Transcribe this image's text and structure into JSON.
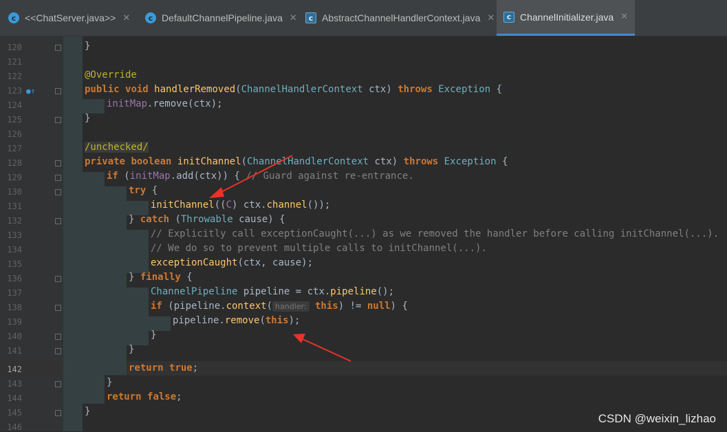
{
  "tabs": [
    {
      "label": "<<ChatServer.java>>",
      "icon": "class-icon",
      "active": false
    },
    {
      "label": "DefaultChannelPipeline.java",
      "icon": "class-icon",
      "active": false
    },
    {
      "label": "AbstractChannelHandlerContext.java",
      "icon": "abstract-class-icon",
      "active": false
    },
    {
      "label": "ChannelInitializer.java",
      "icon": "abstract-class-icon",
      "active": true
    }
  ],
  "close_glyph": "✕",
  "line_numbers": [
    "120",
    "121",
    "122",
    "123",
    "124",
    "125",
    "126",
    "127",
    "128",
    "129",
    "130",
    "131",
    "132",
    "133",
    "134",
    "135",
    "136",
    "137",
    "138",
    "139",
    "140",
    "141",
    "142",
    "143",
    "144",
    "145",
    "146"
  ],
  "current_line": "142",
  "code": {
    "l120": {
      "brace": "}"
    },
    "l122": {
      "annotation": "@Override"
    },
    "l123": {
      "kw1": "public",
      "kw2": "void",
      "name": "handlerRemoved",
      "p1": "(",
      "ptype": "ChannelHandlerContext",
      "pname": " ctx) ",
      "throws": "throws",
      "ex": "Exception",
      "brace": " {"
    },
    "l124": {
      "field": "initMap",
      "call": ".remove(ctx);"
    },
    "l125": {
      "brace": "}"
    },
    "l127": {
      "annotation": "/unchecked/"
    },
    "l128": {
      "kw1": "private",
      "kw2": "boolean",
      "name": "initChannel",
      "p1": "(",
      "ptype": "ChannelHandlerContext",
      "pname": " ctx) ",
      "throws": "throws",
      "ex": "Exception",
      "brace": " {"
    },
    "l129": {
      "kw": "if",
      "open": " (",
      "field": "initMap",
      "call": ".add(ctx)) { ",
      "comment": "// Guard against re-entrance."
    },
    "l130": {
      "kw": "try",
      "brace": " {"
    },
    "l131": {
      "fn": "initChannel",
      "rest1": "((",
      "gen": "C",
      "rest2": ") ctx.",
      "ch": "channel",
      "rest3": "());"
    },
    "l132": {
      "close": "} ",
      "kw": "catch",
      "open": " (",
      "ty": "Throwable",
      "rest": " cause) {"
    },
    "l133": {
      "comment": "// Explicitly call exceptionCaught(...) as we removed the handler before calling initChannel(...)."
    },
    "l134": {
      "comment": "// We do so to prevent multiple calls to initChannel(...)."
    },
    "l135": {
      "fn": "exceptionCaught",
      "rest": "(ctx, cause);"
    },
    "l136": {
      "close": "} ",
      "kw": "finally",
      "brace": " {"
    },
    "l137": {
      "ty": "ChannelPipeline",
      "rest1": " pipeline = ctx.",
      "call": "pipeline",
      "rest2": "();"
    },
    "l138": {
      "kw": "if",
      "rest1": " (pipeline.",
      "call": "context",
      "p": "(",
      "hint": "handler:",
      "this": "this",
      "rest2": ") != ",
      "null": "null",
      "brace": ") {"
    },
    "l139": {
      "rest1": "pipeline.",
      "call": "remove",
      "p": "(",
      "this": "this",
      "rest2": ");"
    },
    "l140": {
      "brace": "}"
    },
    "l141": {
      "brace": "}"
    },
    "l142": {
      "kw": "return",
      "val": "true",
      "semi": ";"
    },
    "l143": {
      "brace": "}"
    },
    "l144": {
      "kw": "return",
      "val": "false",
      "semi": ";"
    },
    "l145": {
      "brace": "}"
    }
  },
  "watermark": "CSDN @weixin_lizhao",
  "colors": {
    "accent": "#4a88c7",
    "arrow": "#e8322a",
    "keyword": "#cc7832",
    "annotation": "#bbb529"
  }
}
